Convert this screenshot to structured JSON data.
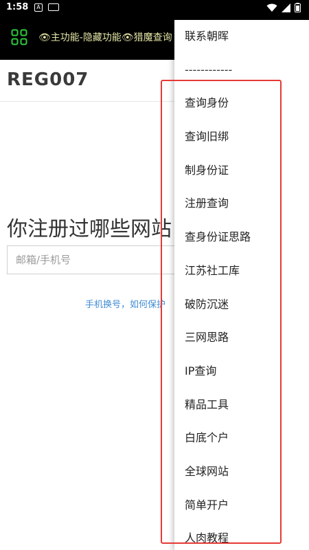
{
  "status_bar": {
    "time": "1:58",
    "icons": [
      "a-icon",
      "keyboard-icon",
      "wifi-icon",
      "signal-icon",
      "battery-icon"
    ]
  },
  "toolbar": {
    "icon": "grid-icon",
    "title": "👁主功能-隐藏功能👁猎魔查询",
    "accent": "#2ecc40"
  },
  "site": {
    "logo": "REG007",
    "heading": "你注册过哪些网站",
    "search_placeholder": "邮箱/手机号",
    "help_link": "手机换号，如何保护"
  },
  "menu": {
    "items": [
      "联系朝晖",
      "------------",
      "查询身份",
      "查询旧绑",
      "制身份证",
      "注册查询",
      "查身份证思路",
      "江苏社工库",
      "破防沉迷",
      "三网思路",
      "IP查询",
      "精品工具",
      "白底个户",
      "全球网站",
      "简单开户",
      "人肉教程"
    ]
  },
  "colors": {
    "highlight": "#e53935",
    "link": "#3f8bd2"
  }
}
